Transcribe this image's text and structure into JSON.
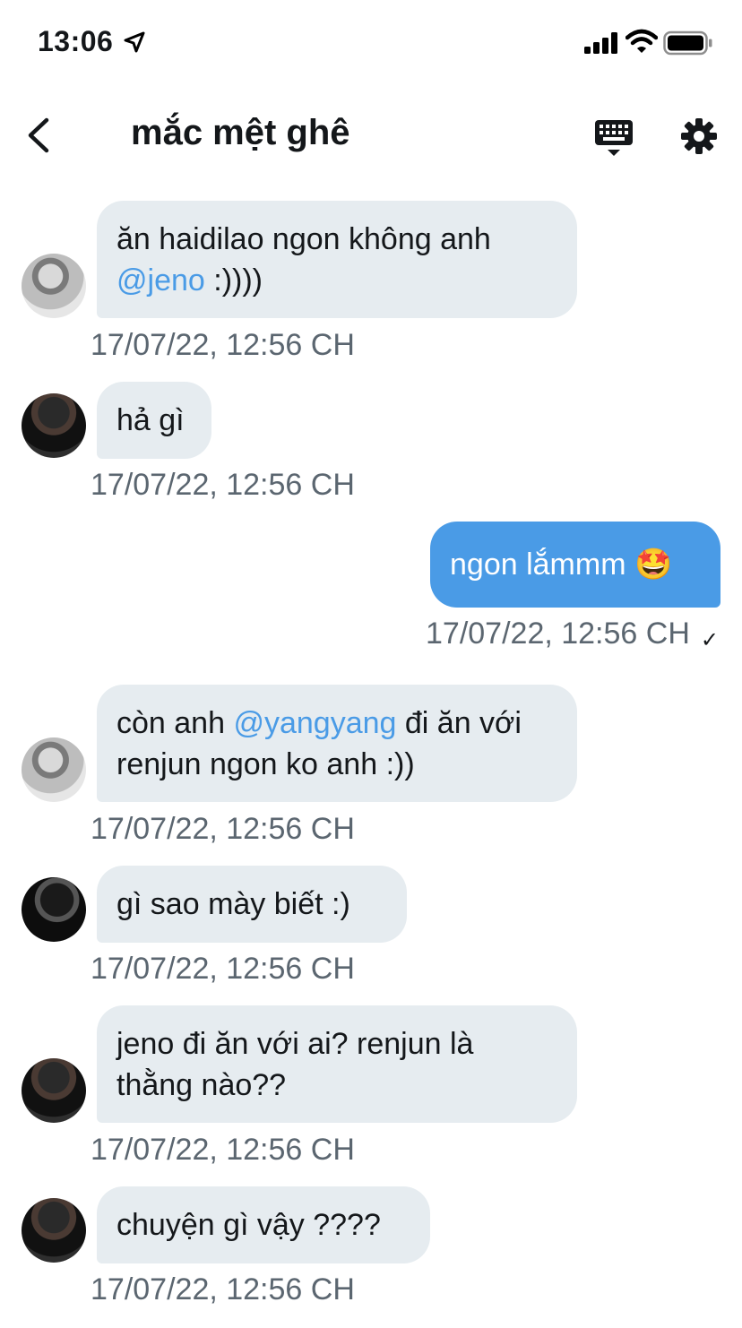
{
  "status_bar": {
    "time": "13:06"
  },
  "header": {
    "title": "mắc mệt ghê"
  },
  "messages": [
    {
      "direction": "in",
      "avatar": "avatar-1",
      "text_before": "ăn haidilao ngon không anh",
      "mention": "@jeno",
      "text_after": " :))))",
      "timestamp": "17/07/22, 12:56 CH"
    },
    {
      "direction": "in",
      "avatar": "avatar-2",
      "text": "hả gì",
      "timestamp": "17/07/22, 12:56 CH"
    },
    {
      "direction": "out",
      "text": "ngon lắmmm 🤩",
      "timestamp": "17/07/22, 12:56 CH",
      "read_mark": "✓"
    },
    {
      "direction": "in",
      "avatar": "avatar-1",
      "text_before": "còn anh ",
      "mention": "@yangyang",
      "text_after": " đi ăn với renjun ngon ko anh :))",
      "timestamp": "17/07/22, 12:56 CH"
    },
    {
      "direction": "in",
      "avatar": "avatar-3",
      "text": "gì sao mày biết :)",
      "timestamp": "17/07/22, 12:56 CH"
    },
    {
      "direction": "in",
      "avatar": "avatar-2",
      "text": "jeno đi ăn với ai? renjun là thằng nào??",
      "timestamp": "17/07/22, 12:56 CH"
    },
    {
      "direction": "in",
      "avatar": "avatar-2",
      "text": "chuyện gì vậy ????",
      "timestamp": "17/07/22, 12:56 CH"
    }
  ],
  "colors": {
    "accent": "#4a9be6",
    "bubble_in": "#e6ecf0",
    "timestamp": "#5b6670"
  }
}
